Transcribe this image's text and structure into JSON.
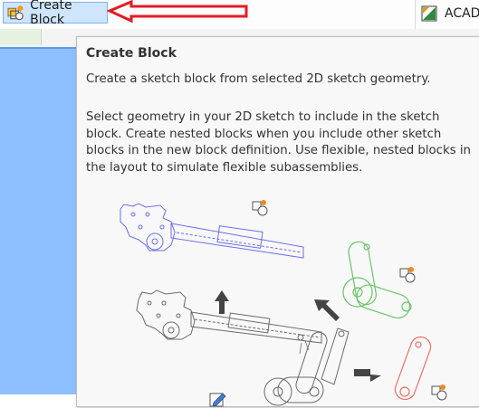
{
  "ribbon": {
    "create_block_label": "Create Block",
    "acad_label": "ACAD"
  },
  "tooltip": {
    "title": "Create Block",
    "summary": "Create a sketch block from selected 2D sketch geometry.",
    "body": "Select geometry in your 2D sketch to include in the sketch block. Create nested blocks when you include other sketch blocks in the new block definition. Use flexible, nested blocks in the layout to simulate flexible subassemblies."
  },
  "icons": {
    "create_block": "create-block-icon",
    "acad": "acad-icon",
    "annotation_arrow": "red-arrow-icon",
    "edit": "edit-sketch-icon"
  },
  "colors": {
    "selection_blue": "#cfe5fb",
    "annotation_red": "#e31b23",
    "sketch_blue": "#6a70e6",
    "sketch_green": "#6cc46a",
    "sketch_red": "#ee6f6a",
    "sketch_gray": "#6b6b6b"
  }
}
